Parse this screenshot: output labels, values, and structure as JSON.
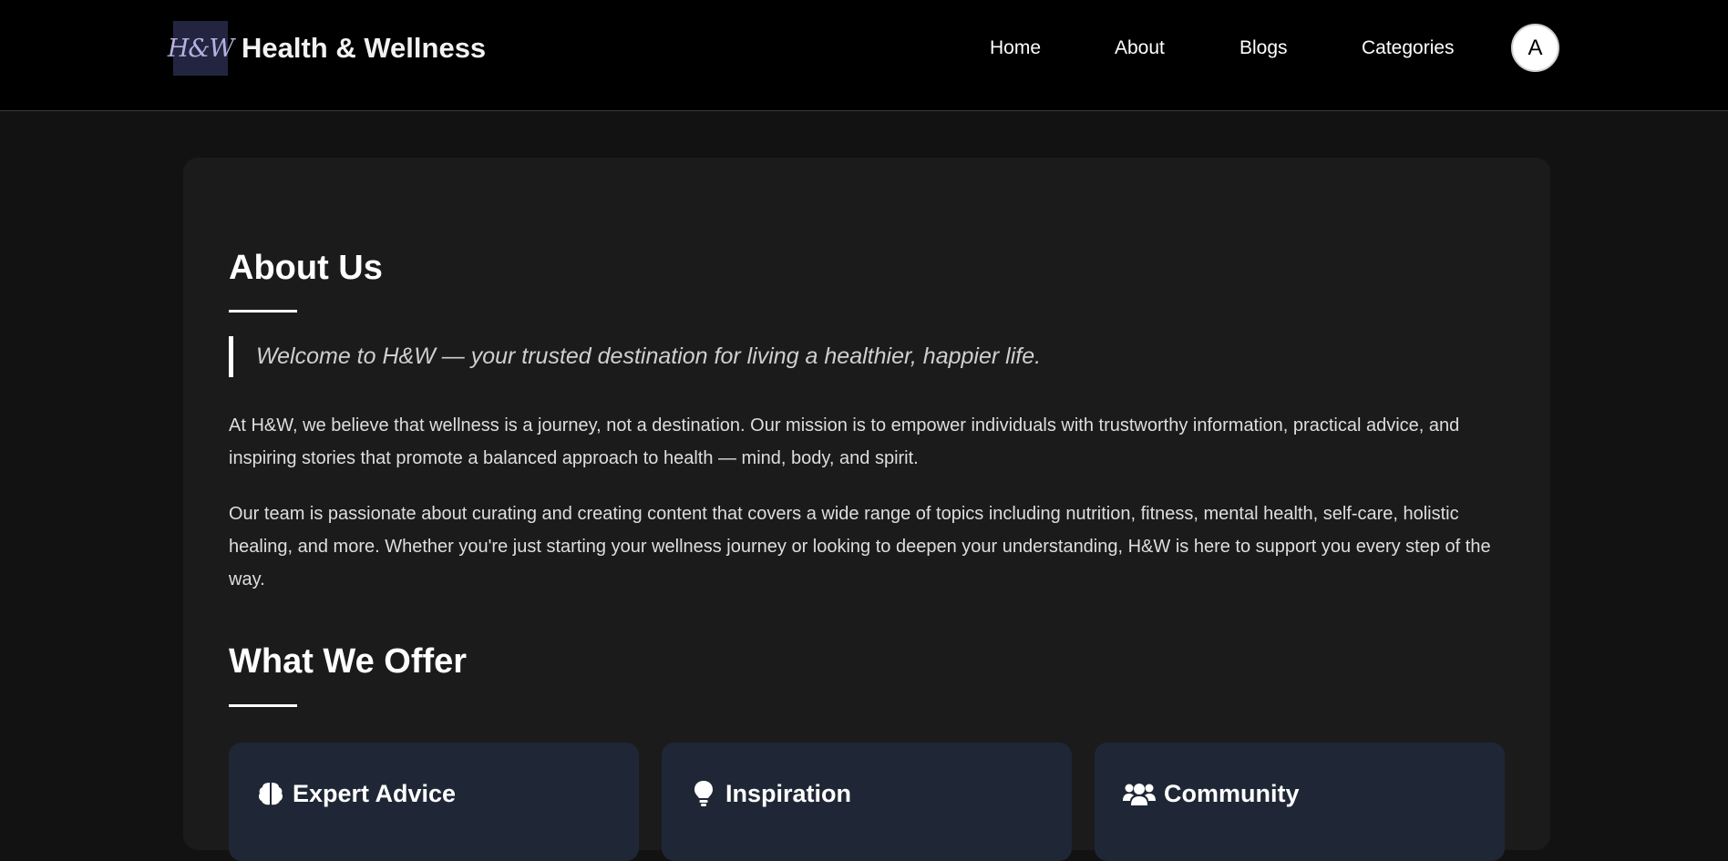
{
  "header": {
    "logo_text": "H&W",
    "brand_name": "Health & Wellness",
    "nav": [
      "Home",
      "About",
      "Blogs",
      "Categories"
    ],
    "avatar_letter": "A"
  },
  "about": {
    "title": "About Us",
    "quote": "Welcome to H&W — your trusted destination for living a healthier, happier life.",
    "paragraphs": [
      "At H&W, we believe that wellness is a journey, not a destination. Our mission is to empower individuals with trustworthy information, practical advice, and inspiring stories that promote a balanced approach to health — mind, body, and spirit.",
      "Our team is passionate about curating and creating content that covers a wide range of topics including nutrition, fitness, mental health, self-care, holistic healing, and more. Whether you're just starting your wellness journey or looking to deepen your understanding, H&W is here to support you every step of the way."
    ]
  },
  "offer": {
    "title": "What We Offer",
    "items": [
      {
        "icon": "brain-icon",
        "title": "Expert Advice"
      },
      {
        "icon": "lightbulb-icon",
        "title": "Inspiration"
      },
      {
        "icon": "users-icon",
        "title": "Community"
      }
    ]
  },
  "colors": {
    "page_bg": "#121212",
    "navbar_bg": "#000000",
    "card_bg": "#1b1b1b",
    "offer_card_bg": "#1f2736",
    "logo_bg": "#232540"
  }
}
